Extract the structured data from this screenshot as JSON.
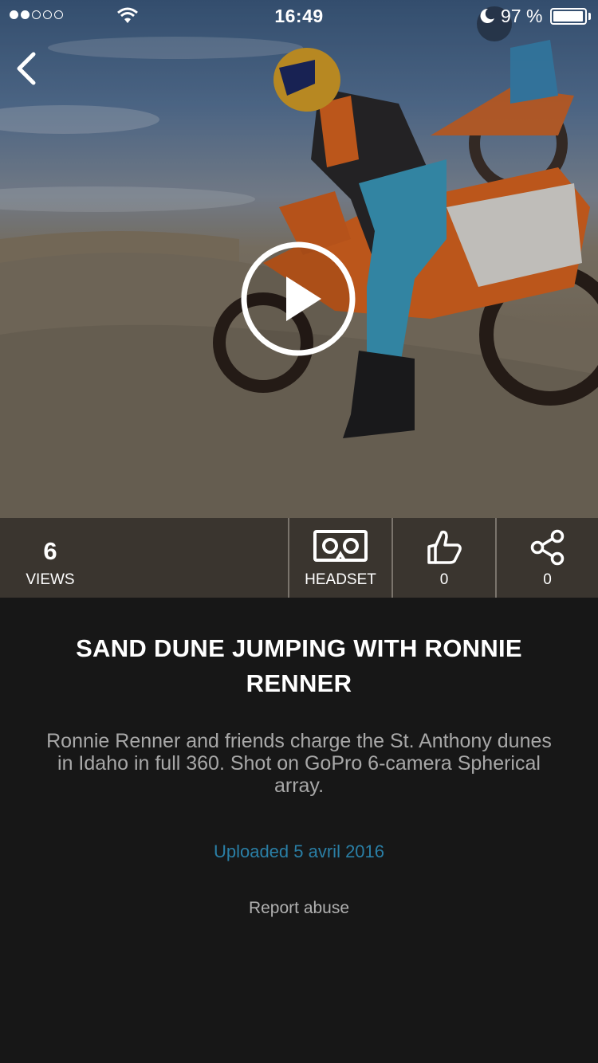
{
  "status_bar": {
    "signal_filled": 2,
    "signal_total": 5,
    "time": "16:49",
    "battery_percent": "97 %",
    "battery_level": 0.97
  },
  "hero": {
    "back_icon": "chevron-left-icon",
    "play_icon": "play-circle-icon"
  },
  "stats": {
    "views_count": "6",
    "views_label": "VIEWS",
    "headset_label": "HEADSET",
    "likes_count": "0",
    "shares_count": "0"
  },
  "video": {
    "title": "SAND DUNE JUMPING WITH RONNIE RENNER",
    "description": "Ronnie Renner and friends charge the St. Anthony dunes in Idaho in full 360. Shot on GoPro 6-camera Spherical array.",
    "uploaded": "Uploaded 5 avril 2016",
    "report_label": "Report abuse"
  },
  "colors": {
    "background": "#171717",
    "stats_bar": "#3a352f",
    "link_blue": "#2a7fa6",
    "description_gray": "#a8a8a8"
  }
}
